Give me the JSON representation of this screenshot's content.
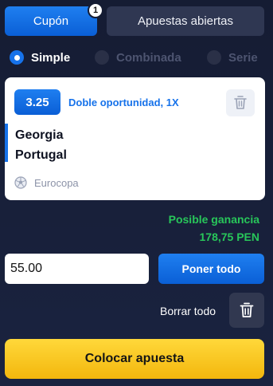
{
  "tabs": {
    "coupon_label": "Cupón",
    "coupon_badge": "1",
    "open_bets_label": "Apuestas abiertas"
  },
  "bet_types": [
    {
      "label": "Simple",
      "selected": true
    },
    {
      "label": "Combinada",
      "selected": false
    },
    {
      "label": "Serie",
      "selected": false
    }
  ],
  "selection": {
    "odds": "3.25",
    "market": "Doble oportunidad, 1X",
    "team_home": "Georgia",
    "team_away": "Portugal",
    "league": "Eurocopa",
    "league_icon": "soccer-ball-icon",
    "remove_icon": "trash-icon"
  },
  "winnings": {
    "label": "Posible ganancia",
    "value": "178,75 PEN"
  },
  "stake": {
    "value": "55.00",
    "all_in_label": "Poner todo"
  },
  "clear": {
    "label": "Borrar todo",
    "icon": "trash-icon"
  },
  "place_bet_label": "Colocar apuesta",
  "colors": {
    "accent_blue": "#1672ea",
    "gain_green": "#28c65a",
    "cta_yellow": "#ffd23a",
    "background": "#151c33"
  }
}
